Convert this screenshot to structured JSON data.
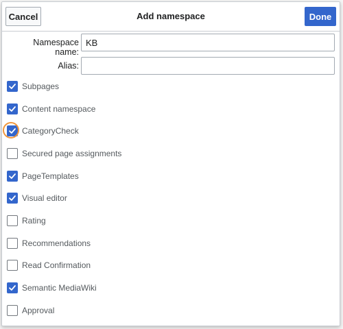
{
  "header": {
    "cancel_label": "Cancel",
    "title": "Add namespace",
    "done_label": "Done"
  },
  "form": {
    "namespace_name_label": "Namespace name:",
    "namespace_name_value": "KB",
    "alias_label": "Alias:",
    "alias_value": ""
  },
  "options": [
    {
      "label": "Subpages",
      "checked": true
    },
    {
      "label": "Content namespace",
      "checked": true
    },
    {
      "label": "CategoryCheck",
      "checked": true
    },
    {
      "label": "Secured page assignments",
      "checked": false
    },
    {
      "label": "PageTemplates",
      "checked": true
    },
    {
      "label": "Visual editor",
      "checked": true
    },
    {
      "label": "Rating",
      "checked": false
    },
    {
      "label": "Recommendations",
      "checked": false
    },
    {
      "label": "Read Confirmation",
      "checked": false
    },
    {
      "label": "Semantic MediaWiki",
      "checked": true
    },
    {
      "label": "Approval",
      "checked": false
    }
  ],
  "colors": {
    "accent": "#3366cc",
    "highlight": "#f0963c"
  }
}
